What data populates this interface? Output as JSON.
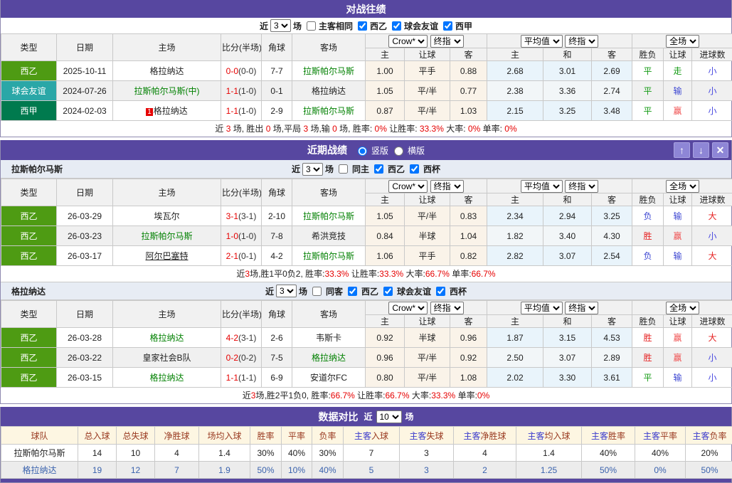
{
  "theme": {
    "accent": "#5747a0",
    "red": "#e60000",
    "green": "#008000",
    "blue": "#3c46d2"
  },
  "selects": {
    "crow": "Crow*",
    "final1": "终指",
    "avg": "平均值",
    "final2": "终指",
    "full": "全场"
  },
  "cols": {
    "type": "类型",
    "date": "日期",
    "home": "主场",
    "score": "比分(半场)",
    "corner": "角球",
    "away": "客场",
    "h": "主",
    "handicap": "让球",
    "a": "客",
    "h2": "主",
    "d": "和",
    "a2": "客",
    "result": "胜负",
    "let": "让球",
    "goals": "进球数"
  },
  "h2h": {
    "title": "对战往绩",
    "filter": {
      "near": "近",
      "games": "3",
      "chang": "场",
      "same": "主客相同",
      "same_checked": false,
      "leagues": [
        {
          "label": "西乙",
          "checked": true
        },
        {
          "label": "球会友谊",
          "checked": true
        },
        {
          "label": "西甲",
          "checked": true
        }
      ]
    },
    "rows": [
      {
        "type": "西乙",
        "type_color": "#4e9b13",
        "date": "2025-10-11",
        "badge": "",
        "home": "格拉纳达",
        "home_color": "#222222",
        "score_ft": "0-0",
        "score_ht": "(0-0)",
        "corner": "7-7",
        "away": "拉斯帕尔马斯",
        "away_color": "#008000",
        "o1": "1.00",
        "o2": "平手",
        "o3": "0.88",
        "a1": "2.68",
        "a2": "3.01",
        "a3": "2.69",
        "r1": "平",
        "r2": "走",
        "r3": "小"
      },
      {
        "type": "球会友谊",
        "type_color": "#2aa7a7",
        "date": "2024-07-26",
        "badge": "",
        "home": "拉斯帕尔马斯(中)",
        "home_color": "#008000",
        "score_ft": "1-1",
        "score_ht": "(1-0)",
        "corner": "0-1",
        "away": "格拉纳达",
        "away_color": "#222222",
        "o1": "1.05",
        "o2": "平/半",
        "o3": "0.77",
        "a1": "2.38",
        "a2": "3.36",
        "a3": "2.74",
        "r1": "平",
        "r2": "输",
        "r3": "小"
      },
      {
        "type": "西甲",
        "type_color": "#007a4e",
        "date": "2024-02-03",
        "badge": "1",
        "home": "格拉纳达",
        "home_color": "#222222",
        "score_ft": "1-1",
        "score_ht": "(1-0)",
        "corner": "2-9",
        "away": "拉斯帕尔马斯",
        "away_color": "#008000",
        "o1": "0.87",
        "o2": "平/半",
        "o3": "1.03",
        "a1": "2.15",
        "a2": "3.25",
        "a3": "3.48",
        "r1": "平",
        "r2": "赢",
        "r3": "小"
      }
    ],
    "summary": [
      {
        "t": "近 "
      },
      {
        "t": "3",
        "r": 1
      },
      {
        "t": " 场, 胜出 "
      },
      {
        "t": "0",
        "r": 1
      },
      {
        "t": " 场,平局 "
      },
      {
        "t": "3",
        "r": 1
      },
      {
        "t": " 场,输 "
      },
      {
        "t": "0",
        "r": 1
      },
      {
        "t": " 场, 胜率: "
      },
      {
        "t": "0%",
        "r": 1
      },
      {
        "t": " 让胜率: "
      },
      {
        "t": "33.3%",
        "r": 1
      },
      {
        "t": " 大率: "
      },
      {
        "t": "0%",
        "r": 1
      },
      {
        "t": " 单率: "
      },
      {
        "t": "0%",
        "r": 1
      }
    ]
  },
  "recent": {
    "title": "近期战绩",
    "layout_options": {
      "vertical": "竖版",
      "vertical_checked": true,
      "horizontal": "横版",
      "horizontal_checked": false
    },
    "window_buttons": {
      "up": "↑",
      "down": "↓",
      "close": "✕"
    },
    "teams": [
      {
        "name": "拉斯帕尔马斯",
        "filter": {
          "near": "近",
          "games": "3",
          "chang": "场",
          "same": "同主",
          "same_checked": false,
          "leagues": [
            {
              "label": "西乙",
              "checked": true
            },
            {
              "label": "西杯",
              "checked": true
            }
          ]
        },
        "rows": [
          {
            "type": "西乙",
            "type_color": "#4e9b13",
            "date": "26-03-29",
            "badge": "",
            "home": "埃瓦尔",
            "home_color": "#222222",
            "score_ft": "3-1",
            "score_ht": "(3-1)",
            "corner": "2-10",
            "away": "拉斯帕尔马斯",
            "away_color": "#008000",
            "o1": "1.05",
            "o2": "平/半",
            "o3": "0.83",
            "a1": "2.34",
            "a2": "2.94",
            "a3": "3.25",
            "r1": "负",
            "r2": "输",
            "r3": "大"
          },
          {
            "type": "西乙",
            "type_color": "#4e9b13",
            "date": "26-03-23",
            "badge": "",
            "home": "拉斯帕尔马斯",
            "home_color": "#008000",
            "score_ft": "1-0",
            "score_ht": "(1-0)",
            "corner": "7-8",
            "away": "希洪竞技",
            "away_color": "#222222",
            "o1": "0.84",
            "o2": "半球",
            "o3": "1.04",
            "a1": "1.82",
            "a2": "3.40",
            "a3": "4.30",
            "r1": "胜",
            "r2": "赢",
            "r3": "小"
          },
          {
            "type": "西乙",
            "type_color": "#4e9b13",
            "date": "26-03-17",
            "badge": "",
            "home": "阿尔巴塞特",
            "home_color": "#222222",
            "home_deco": "underline",
            "score_ft": "2-1",
            "score_ht": "(0-1)",
            "corner": "4-2",
            "away": "拉斯帕尔马斯",
            "away_color": "#008000",
            "o1": "1.06",
            "o2": "平手",
            "o3": "0.82",
            "a1": "2.82",
            "a2": "3.07",
            "a3": "2.54",
            "r1": "负",
            "r2": "输",
            "r3": "大"
          }
        ],
        "summary": [
          {
            "t": "近"
          },
          {
            "t": "3",
            "r": 1
          },
          {
            "t": "场,胜1平0负2, 胜率:"
          },
          {
            "t": "33.3%",
            "r": 1
          },
          {
            "t": " 让胜率:"
          },
          {
            "t": "33.3%",
            "r": 1
          },
          {
            "t": " 大率:"
          },
          {
            "t": "66.7%",
            "r": 1
          },
          {
            "t": " 单率:"
          },
          {
            "t": "66.7%",
            "r": 1
          }
        ]
      },
      {
        "name": "格拉纳达",
        "filter": {
          "near": "近",
          "games": "3",
          "chang": "场",
          "same": "同客",
          "same_checked": false,
          "leagues": [
            {
              "label": "西乙",
              "checked": true
            },
            {
              "label": "球会友谊",
              "checked": true
            },
            {
              "label": "西杯",
              "checked": true
            }
          ]
        },
        "rows": [
          {
            "type": "西乙",
            "type_color": "#4e9b13",
            "date": "26-03-28",
            "badge": "",
            "home": "格拉纳达",
            "home_color": "#008000",
            "score_ft": "4-2",
            "score_ht": "(3-1)",
            "corner": "2-6",
            "away": "韦斯卡",
            "away_color": "#222222",
            "o1": "0.92",
            "o2": "半球",
            "o3": "0.96",
            "a1": "1.87",
            "a2": "3.15",
            "a3": "4.53",
            "r1": "胜",
            "r2": "赢",
            "r3": "大"
          },
          {
            "type": "西乙",
            "type_color": "#4e9b13",
            "date": "26-03-22",
            "badge": "",
            "home": "皇家社会B队",
            "home_color": "#222222",
            "score_ft": "0-2",
            "score_ht": "(0-2)",
            "corner": "7-5",
            "away": "格拉纳达",
            "away_color": "#008000",
            "o1": "0.96",
            "o2": "平/半",
            "o3": "0.92",
            "a1": "2.50",
            "a2": "3.07",
            "a3": "2.89",
            "r1": "胜",
            "r2": "赢",
            "r3": "小"
          },
          {
            "type": "西乙",
            "type_color": "#4e9b13",
            "date": "26-03-15",
            "badge": "",
            "home": "格拉纳达",
            "home_color": "#008000",
            "score_ft": "1-1",
            "score_ht": "(1-1)",
            "corner": "6-9",
            "away": "安道尔FC",
            "away_color": "#222222",
            "o1": "0.80",
            "o2": "平/半",
            "o3": "1.08",
            "a1": "2.02",
            "a2": "3.30",
            "a3": "3.61",
            "r1": "平",
            "r2": "输",
            "r3": "小"
          }
        ],
        "summary": [
          {
            "t": "近"
          },
          {
            "t": "3",
            "r": 1
          },
          {
            "t": "场,胜2平1负0, 胜率:"
          },
          {
            "t": "66.7%",
            "r": 1
          },
          {
            "t": " 让胜率:"
          },
          {
            "t": "66.7%",
            "r": 1
          },
          {
            "t": " 大率:"
          },
          {
            "t": "33.3%",
            "r": 1
          },
          {
            "t": " 单率:"
          },
          {
            "t": "0%",
            "r": 1
          }
        ]
      }
    ]
  },
  "comparison": {
    "title": "数据对比",
    "near": "近",
    "games": "10",
    "chang": "场",
    "headers": [
      {
        "b": "",
        "t": "球队"
      },
      {
        "b": "",
        "t": "总入球"
      },
      {
        "b": "",
        "t": "总失球"
      },
      {
        "b": "",
        "t": "净胜球"
      },
      {
        "b": "",
        "t": "场均入球"
      },
      {
        "b": "",
        "t": "胜率"
      },
      {
        "b": "",
        "t": "平率"
      },
      {
        "b": "",
        "t": "负率"
      },
      {
        "b": "主客",
        "t": "入球"
      },
      {
        "b": "主客",
        "t": "失球"
      },
      {
        "b": "主客",
        "t": "净胜球"
      },
      {
        "b": "主客",
        "t": "均入球"
      },
      {
        "b": "主客",
        "t": "胜率"
      },
      {
        "b": "主客",
        "t": "平率"
      },
      {
        "b": "主客",
        "t": "负率"
      }
    ],
    "rows": [
      {
        "team": "拉斯帕尔马斯",
        "vals": [
          "14",
          "10",
          "4",
          "1.4",
          "30%",
          "40%",
          "30%",
          "7",
          "3",
          "4",
          "1.4",
          "40%",
          "40%",
          "20%"
        ]
      },
      {
        "team": "格拉纳达",
        "vals": [
          "19",
          "12",
          "7",
          "1.9",
          "50%",
          "10%",
          "40%",
          "5",
          "3",
          "2",
          "1.25",
          "50%",
          "0%",
          "50%"
        ]
      }
    ]
  }
}
